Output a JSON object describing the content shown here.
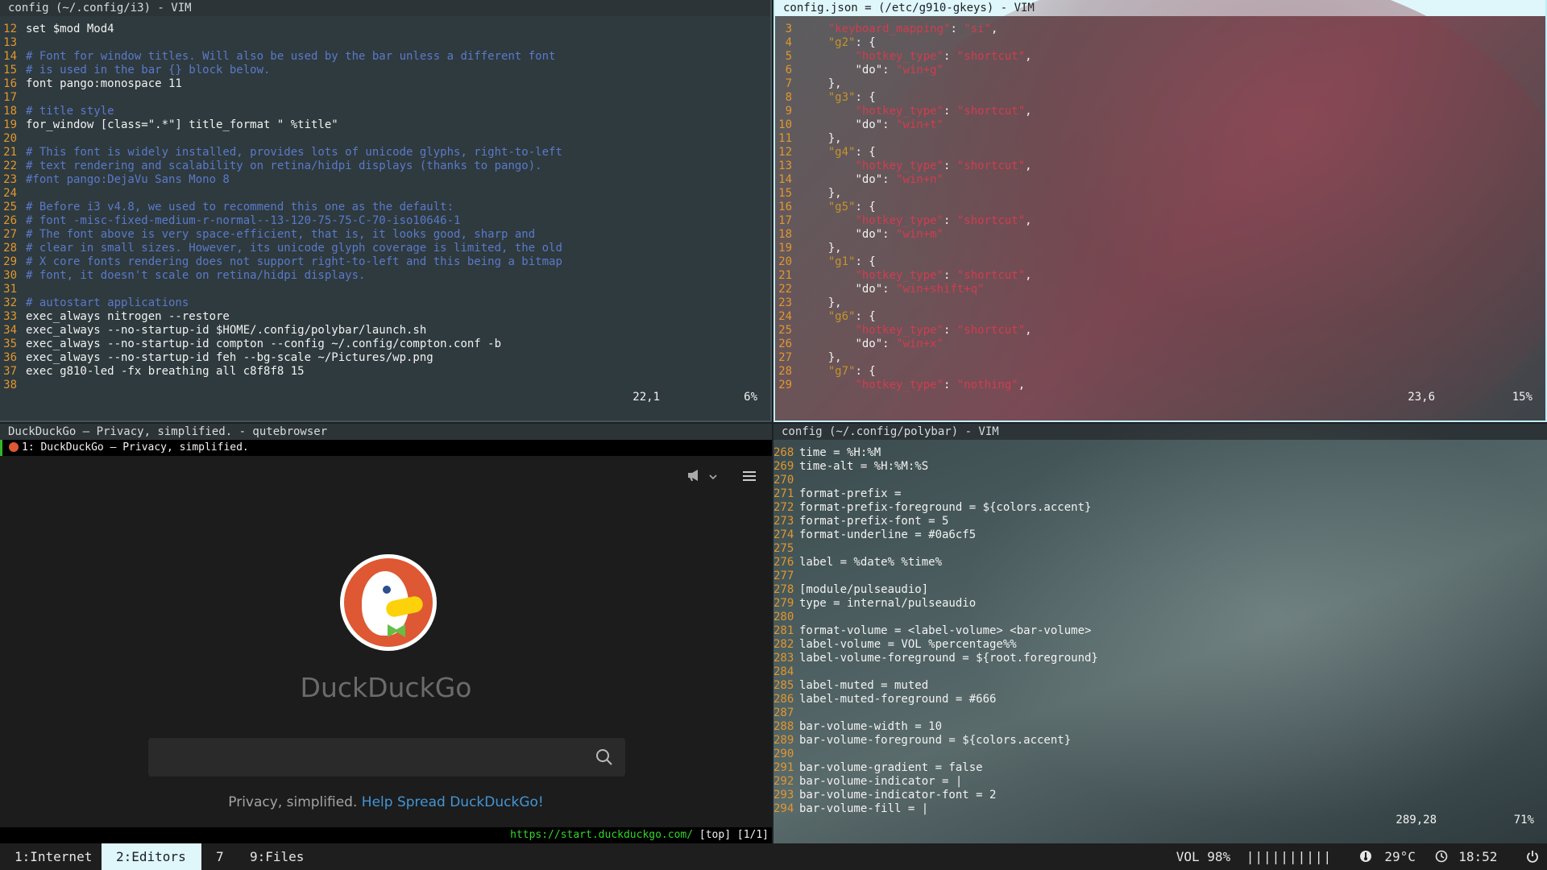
{
  "i3_editor": {
    "title": "config (~/.config/i3) - VIM",
    "lines": [
      {
        "n": "12",
        "t": "set $mod Mod4",
        "c": "def"
      },
      {
        "n": "13",
        "t": "",
        "c": "def"
      },
      {
        "n": "14",
        "t": "# Font for window titles. Will also be used by the bar unless a different font",
        "c": "com"
      },
      {
        "n": "15",
        "t": "# is used in the bar {} block below.",
        "c": "com"
      },
      {
        "n": "16",
        "t": "font pango:monospace 11",
        "c": "def"
      },
      {
        "n": "17",
        "t": "",
        "c": "def"
      },
      {
        "n": "18",
        "t": "# title style",
        "c": "com"
      },
      {
        "n": "19",
        "t": "for_window [class=\".*\"] title_format \" %title\"",
        "c": "def"
      },
      {
        "n": "20",
        "t": "",
        "c": "def"
      },
      {
        "n": "21",
        "t": "# This font is widely installed, provides lots of unicode glyphs, right-to-left",
        "c": "com"
      },
      {
        "n": "22",
        "t": "# text rendering and scalability on retina/hidpi displays (thanks to pango).",
        "c": "com"
      },
      {
        "n": "23",
        "t": "#font pango:DejaVu Sans Mono 8",
        "c": "com"
      },
      {
        "n": "24",
        "t": "",
        "c": "def"
      },
      {
        "n": "25",
        "t": "# Before i3 v4.8, we used to recommend this one as the default:",
        "c": "com"
      },
      {
        "n": "26",
        "t": "# font -misc-fixed-medium-r-normal--13-120-75-75-C-70-iso10646-1",
        "c": "com"
      },
      {
        "n": "27",
        "t": "# The font above is very space-efficient, that is, it looks good, sharp and",
        "c": "com"
      },
      {
        "n": "28",
        "t": "# clear in small sizes. However, its unicode glyph coverage is limited, the old",
        "c": "com"
      },
      {
        "n": "29",
        "t": "# X core fonts rendering does not support right-to-left and this being a bitmap",
        "c": "com"
      },
      {
        "n": "30",
        "t": "# font, it doesn't scale on retina/hidpi displays.",
        "c": "com"
      },
      {
        "n": "31",
        "t": "",
        "c": "def"
      },
      {
        "n": "32",
        "t": "# autostart applications",
        "c": "com"
      },
      {
        "n": "33",
        "t": "exec_always nitrogen --restore",
        "c": "def"
      },
      {
        "n": "34",
        "t": "exec_always --no-startup-id $HOME/.config/polybar/launch.sh",
        "c": "def"
      },
      {
        "n": "35",
        "t": "exec_always --no-startup-id compton --config ~/.config/compton.conf -b",
        "c": "def"
      },
      {
        "n": "36",
        "t": "exec_always --no-startup-id feh --bg-scale ~/Pictures/wp.png",
        "c": "def"
      },
      {
        "n": "37",
        "t": "exec g810-led -fx breathing all c8f8f8 15",
        "c": "def"
      },
      {
        "n": "38",
        "t": "",
        "c": "def"
      }
    ],
    "cursor_pos": "22,1",
    "scroll": "6%"
  },
  "gkeys_editor": {
    "title": "config.json = (/etc/g910-gkeys) - VIM",
    "lines": [
      {
        "n": "3",
        "t": "    \"keyboard_mapping\": \"si\","
      },
      {
        "n": "4",
        "t": "    \"g2\": {"
      },
      {
        "n": "5",
        "t": "        \"hotkey_type\": \"shortcut\","
      },
      {
        "n": "6",
        "t": "        \"do\": \"win+g\""
      },
      {
        "n": "7",
        "t": "    },"
      },
      {
        "n": "8",
        "t": "    \"g3\": {"
      },
      {
        "n": "9",
        "t": "        \"hotkey_type\": \"shortcut\","
      },
      {
        "n": "10",
        "t": "        \"do\": \"win+t\""
      },
      {
        "n": "11",
        "t": "    },"
      },
      {
        "n": "12",
        "t": "    \"g4\": {"
      },
      {
        "n": "13",
        "t": "        \"hotkey_type\": \"shortcut\","
      },
      {
        "n": "14",
        "t": "        \"do\": \"win+n\""
      },
      {
        "n": "15",
        "t": "    },"
      },
      {
        "n": "16",
        "t": "    \"g5\": {"
      },
      {
        "n": "17",
        "t": "        \"hotkey_type\": \"shortcut\","
      },
      {
        "n": "18",
        "t": "        \"do\": \"win+m\""
      },
      {
        "n": "19",
        "t": "    },"
      },
      {
        "n": "20",
        "t": "    \"g1\": {"
      },
      {
        "n": "21",
        "t": "        \"hotkey_type\": \"shortcut\","
      },
      {
        "n": "22",
        "t": "        \"do\": \"win+shift+q\""
      },
      {
        "n": "23",
        "t": "    },"
      },
      {
        "n": "24",
        "t": "    \"g6\": {"
      },
      {
        "n": "25",
        "t": "        \"hotkey_type\": \"shortcut\","
      },
      {
        "n": "26",
        "t": "        \"do\": \"win+x\""
      },
      {
        "n": "27",
        "t": "    },"
      },
      {
        "n": "28",
        "t": "    \"g7\": {"
      },
      {
        "n": "29",
        "t": "        \"hotkey_type\": \"nothing\","
      }
    ],
    "cursor_pos": "23,6",
    "scroll": "15%"
  },
  "polybar_editor": {
    "title": "config (~/.config/polybar) - VIM",
    "lines": [
      {
        "n": "268",
        "t": "time = %H:%M"
      },
      {
        "n": "269",
        "t": "time-alt = %H:%M:%S"
      },
      {
        "n": "270",
        "t": ""
      },
      {
        "n": "271",
        "t": "format-prefix = "
      },
      {
        "n": "272",
        "t": "format-prefix-foreground = ${colors.accent}"
      },
      {
        "n": "273",
        "t": "format-prefix-font = 5"
      },
      {
        "n": "274",
        "t": "format-underline = #0a6cf5"
      },
      {
        "n": "275",
        "t": ""
      },
      {
        "n": "276",
        "t": "label = %date% %time%"
      },
      {
        "n": "277",
        "t": ""
      },
      {
        "n": "278",
        "t": "[module/pulseaudio]"
      },
      {
        "n": "279",
        "t": "type = internal/pulseaudio"
      },
      {
        "n": "280",
        "t": ""
      },
      {
        "n": "281",
        "t": "format-volume = <label-volume> <bar-volume>"
      },
      {
        "n": "282",
        "t": "label-volume = VOL %percentage%%"
      },
      {
        "n": "283",
        "t": "label-volume-foreground = ${root.foreground}"
      },
      {
        "n": "284",
        "t": ""
      },
      {
        "n": "285",
        "t": "label-muted = muted"
      },
      {
        "n": "286",
        "t": "label-muted-foreground = #666"
      },
      {
        "n": "287",
        "t": ""
      },
      {
        "n": "288",
        "t": "bar-volume-width = 10"
      },
      {
        "n": "289",
        "t": "bar-volume-foreground = ${colors.accent}"
      },
      {
        "n": "290",
        "t": ""
      },
      {
        "n": "291",
        "t": "bar-volume-gradient = false"
      },
      {
        "n": "292",
        "t": "bar-volume-indicator = |"
      },
      {
        "n": "293",
        "t": "bar-volume-indicator-font = 2"
      },
      {
        "n": "294",
        "t": "bar-volume-fill = |"
      }
    ],
    "cursor_pos": "289,28",
    "scroll": "71%"
  },
  "browser": {
    "title": "DuckDuckGo — Privacy, simplified. - qutebrowser",
    "tab_label": "1: DuckDuckGo — Privacy, simplified.",
    "brand": "DuckDuckGo",
    "tagline": "Privacy, simplified.",
    "tagline_link": "Help Spread DuckDuckGo!",
    "search_placeholder": "",
    "url": "https://start.duckduckgo.com/",
    "scroll_state": "[top] [1/1]"
  },
  "bar": {
    "workspaces": [
      {
        "label": "1:Internet",
        "focused": false
      },
      {
        "label": "2:Editors",
        "focused": true
      },
      {
        "label": "7",
        "focused": false
      },
      {
        "label": "9:Files",
        "focused": false
      }
    ],
    "volume_label": "VOL 98%",
    "volume_bar": "||||||||||",
    "temperature": "29°C",
    "clock": "18:52"
  },
  "colors": {
    "accent": "#dff6fa",
    "line_number": "#e1972e",
    "comment": "#5b79c9",
    "string": "#d03d4f",
    "url_green": "#33d52a",
    "ddg_orange": "#de5833"
  }
}
